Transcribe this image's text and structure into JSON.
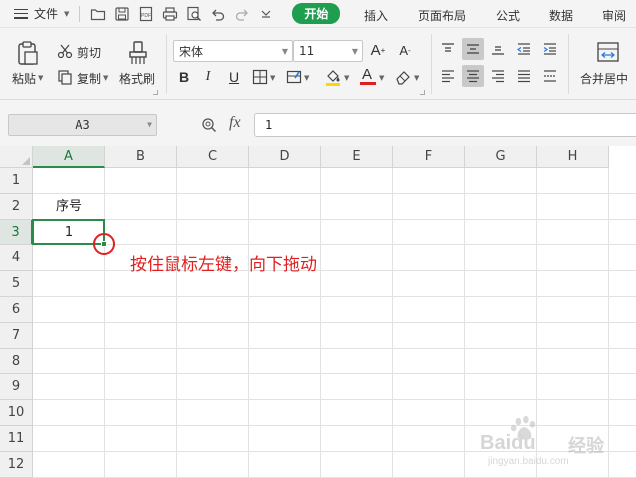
{
  "menu": {
    "file_label": "文件",
    "tabs": {
      "start": "开始",
      "insert": "插入",
      "layout": "页面布局",
      "formula": "公式",
      "data": "数据",
      "review": "审阅"
    },
    "accent_color": "#1d9f4f"
  },
  "ribbon": {
    "cut_label": "剪切",
    "paste_label": "粘贴",
    "copy_label": "复制",
    "format_painter_label": "格式刷",
    "font_name": "宋体",
    "font_size": "11",
    "bold": "B",
    "italic": "I",
    "underline": "U",
    "font_color_letter": "A",
    "merge_center_label": "合并居中"
  },
  "formula_bar": {
    "name_box": "A3",
    "fx_label": "fx",
    "formula_value": "1"
  },
  "sheet": {
    "columns": [
      "A",
      "B",
      "C",
      "D",
      "E",
      "F",
      "G",
      "H"
    ],
    "rows": [
      "1",
      "2",
      "3",
      "4",
      "5",
      "6",
      "7",
      "8",
      "9",
      "10",
      "11",
      "12"
    ],
    "selected_column": "A",
    "selected_row": "3",
    "cells": {
      "A2": "序号",
      "A3": "1"
    }
  },
  "annotation": {
    "text": "按住鼠标左键，向下拖动",
    "color": "#e02020"
  },
  "watermark": {
    "brand": "Baidu",
    "suffix": "经验",
    "url": "jingyan.baidu.com"
  }
}
